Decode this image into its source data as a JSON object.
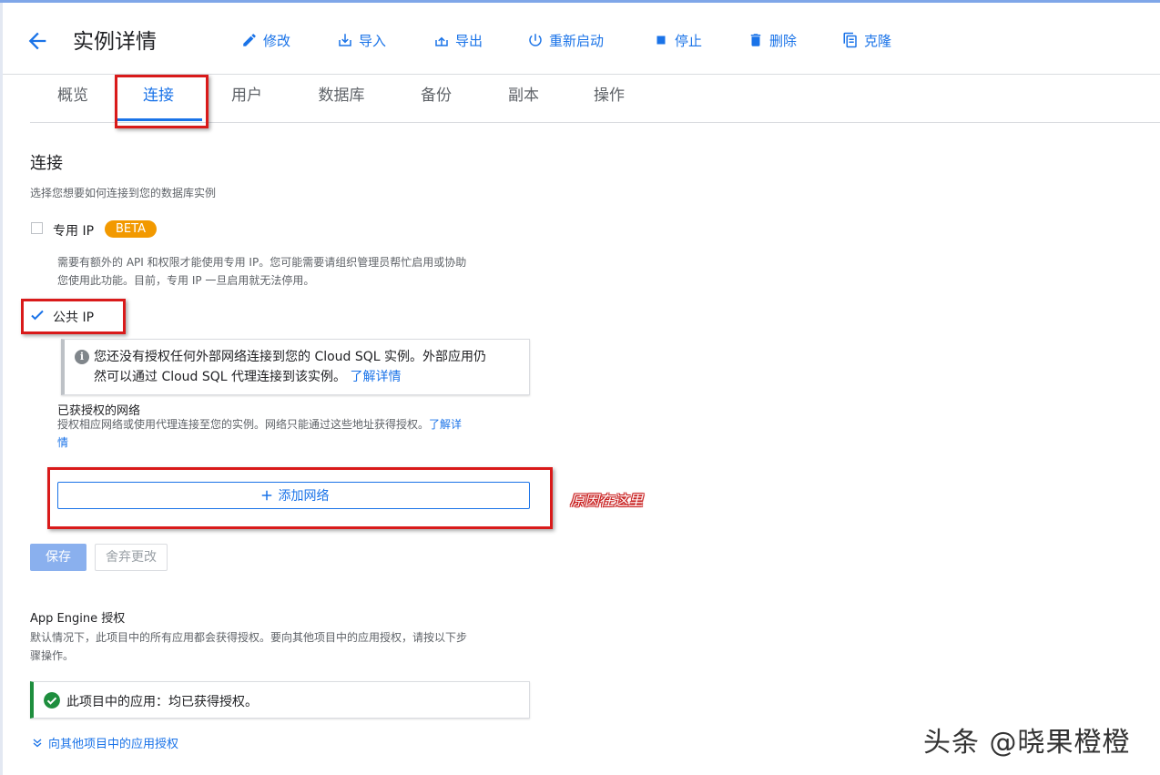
{
  "header": {
    "title": "实例详情",
    "toolbar": {
      "edit": "修改",
      "import": "导入",
      "export": "导出",
      "restart": "重新启动",
      "stop": "停止",
      "delete": "删除",
      "clone": "克隆"
    }
  },
  "tabs": [
    "概览",
    "连接",
    "用户",
    "数据库",
    "备份",
    "副本",
    "操作"
  ],
  "active_tab": "连接",
  "section": {
    "title": "连接",
    "subtitle": "选择您想要如何连接到您的数据库实例"
  },
  "private_ip": {
    "label": "专用 IP",
    "checked": false,
    "badge": "BETA",
    "desc_line1": "需要有额外的 API 和权限才能使用专用 IP。您可能需要请组织管理员帮忙启用或协助",
    "desc_line2": "您使用此功能。目前，专用 IP 一旦启用就无法停用。"
  },
  "public_ip": {
    "label": "公共 IP",
    "checked": true,
    "info_line1": "您还没有授权任何外部网络连接到您的 Cloud SQL 实例。外部应用仍",
    "info_line2": "然可以通过 Cloud SQL 代理连接到该实例。",
    "info_link": "了解详情"
  },
  "authorized_networks": {
    "title": "已获授权的网络",
    "desc_line1": "授权相应网络或使用代理连接至您的实例。网络只能通过这些地址获得授权。",
    "link_part1": "了解详",
    "link_part2": "情",
    "add_button": "添加网络"
  },
  "annotation": "原因在这里",
  "buttons": {
    "save": "保存",
    "discard": "舍弃更改"
  },
  "app_engine": {
    "title": "App Engine 授权",
    "desc_line1": "默认情况下，此项目中的所有应用都会获得授权。要向其他项目中的应用授权，请按以下步",
    "desc_line2": "骤操作。",
    "status": "此项目中的应用：均已获得授权。",
    "expand_link": "向其他项目中的应用授权"
  },
  "watermark": "头条 @晓果橙橙",
  "colors": {
    "accent": "#1a73e8",
    "beta": "#f29900",
    "success": "#1e8e3e",
    "highlight_box": "#d91a1a"
  },
  "icons": [
    "back-arrow-icon",
    "edit-icon",
    "import-icon",
    "export-icon",
    "power-icon",
    "stop-icon",
    "trash-icon",
    "clone-icon",
    "info-icon",
    "plus-icon",
    "check-circle-icon",
    "chevron-double-down-icon"
  ]
}
